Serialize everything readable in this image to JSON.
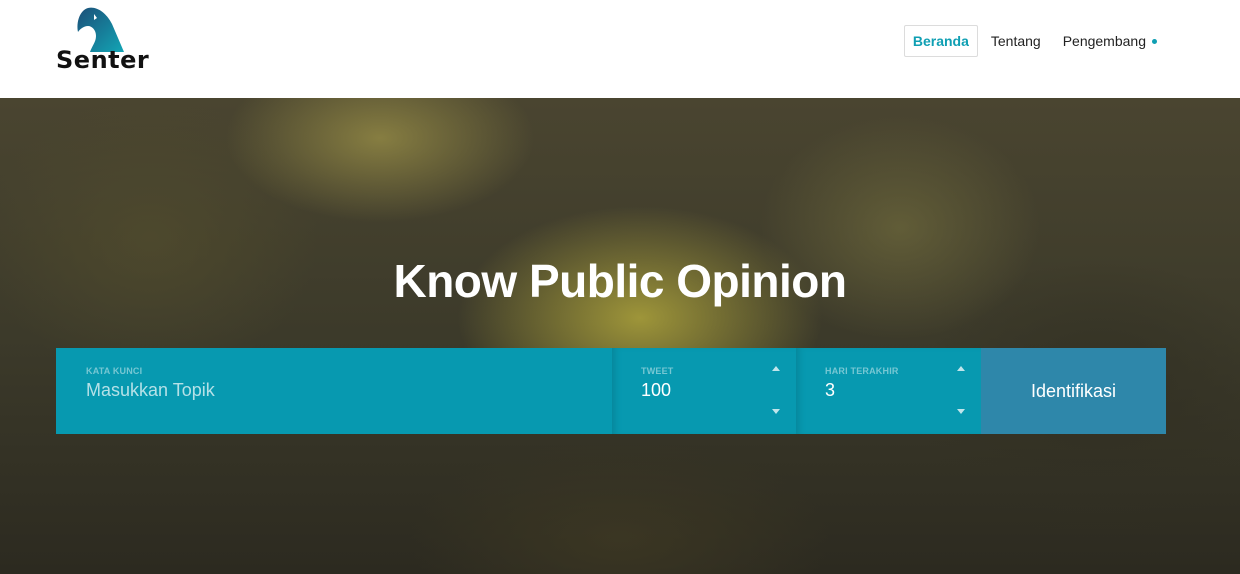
{
  "header": {
    "logo_text": "Senter",
    "nav": [
      {
        "label": "Beranda",
        "active": true
      },
      {
        "label": "Tentang",
        "active": false
      },
      {
        "label": "Pengembang",
        "active": false
      }
    ]
  },
  "hero": {
    "title": "Know Public Opinion"
  },
  "form": {
    "keyword": {
      "label": "KATA KUNCI",
      "placeholder": "Masukkan Topik"
    },
    "tweet": {
      "label": "TWEET",
      "value": "100"
    },
    "days": {
      "label": "HARI TERAKHIR",
      "value": "3"
    },
    "submit_label": "Identifikasi"
  },
  "colors": {
    "accent": "#0f9fb3",
    "form_bg": "#0799b0",
    "button_bg": "#2e87aa"
  }
}
